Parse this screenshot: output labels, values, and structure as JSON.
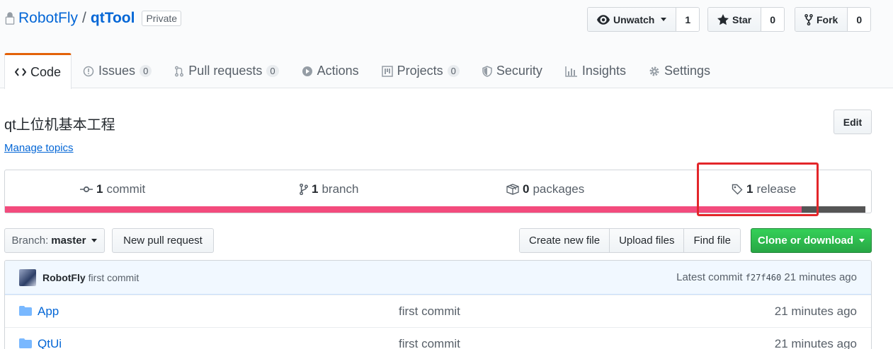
{
  "repo": {
    "owner": "RobotFly",
    "separator": "/",
    "name": "qtTool",
    "visibility": "Private"
  },
  "social": {
    "watch": {
      "label": "Unwatch",
      "count": "1"
    },
    "star": {
      "label": "Star",
      "count": "0"
    },
    "fork": {
      "label": "Fork",
      "count": "0"
    }
  },
  "tabs": [
    {
      "label": "Code",
      "icon": "code-icon",
      "selected": true
    },
    {
      "label": "Issues",
      "icon": "issue-icon",
      "counter": "0"
    },
    {
      "label": "Pull requests",
      "icon": "pull-request-icon",
      "counter": "0"
    },
    {
      "label": "Actions",
      "icon": "play-icon"
    },
    {
      "label": "Projects",
      "icon": "project-icon",
      "counter": "0"
    },
    {
      "label": "Security",
      "icon": "shield-icon"
    },
    {
      "label": "Insights",
      "icon": "graph-icon"
    },
    {
      "label": "Settings",
      "icon": "gear-icon"
    }
  ],
  "about": {
    "description": "qt上位机基本工程",
    "manage_topics": "Manage topics",
    "edit_label": "Edit"
  },
  "summary": {
    "commits": {
      "count": "1",
      "label": "commit"
    },
    "branches": {
      "count": "1",
      "label": "branch"
    },
    "packages": {
      "count": "0",
      "label": "packages"
    },
    "releases": {
      "count": "1",
      "label": "release"
    }
  },
  "languages": [
    {
      "color": "#f34b7d",
      "percent": 92.6
    },
    {
      "color": "#555555",
      "percent": 7.4
    }
  ],
  "toolbar": {
    "branch_prefix": "Branch:",
    "branch_name": "master",
    "new_pr": "New pull request",
    "create_file": "Create new file",
    "upload_files": "Upload files",
    "find_file": "Find file",
    "clone": "Clone or download"
  },
  "latest_commit": {
    "author": "RobotFly",
    "message": "first commit",
    "prefix": "Latest commit",
    "sha": "f27f460",
    "age": "21 minutes ago"
  },
  "files": [
    {
      "name": "App",
      "message": "first commit",
      "age": "21 minutes ago"
    },
    {
      "name": "QtUi",
      "message": "first commit",
      "age": "21 minutes ago"
    }
  ],
  "colors": {
    "link": "#0366d6",
    "tab_accent": "#e36209",
    "clone_green": "#28a745",
    "highlight": "#e3262a"
  }
}
